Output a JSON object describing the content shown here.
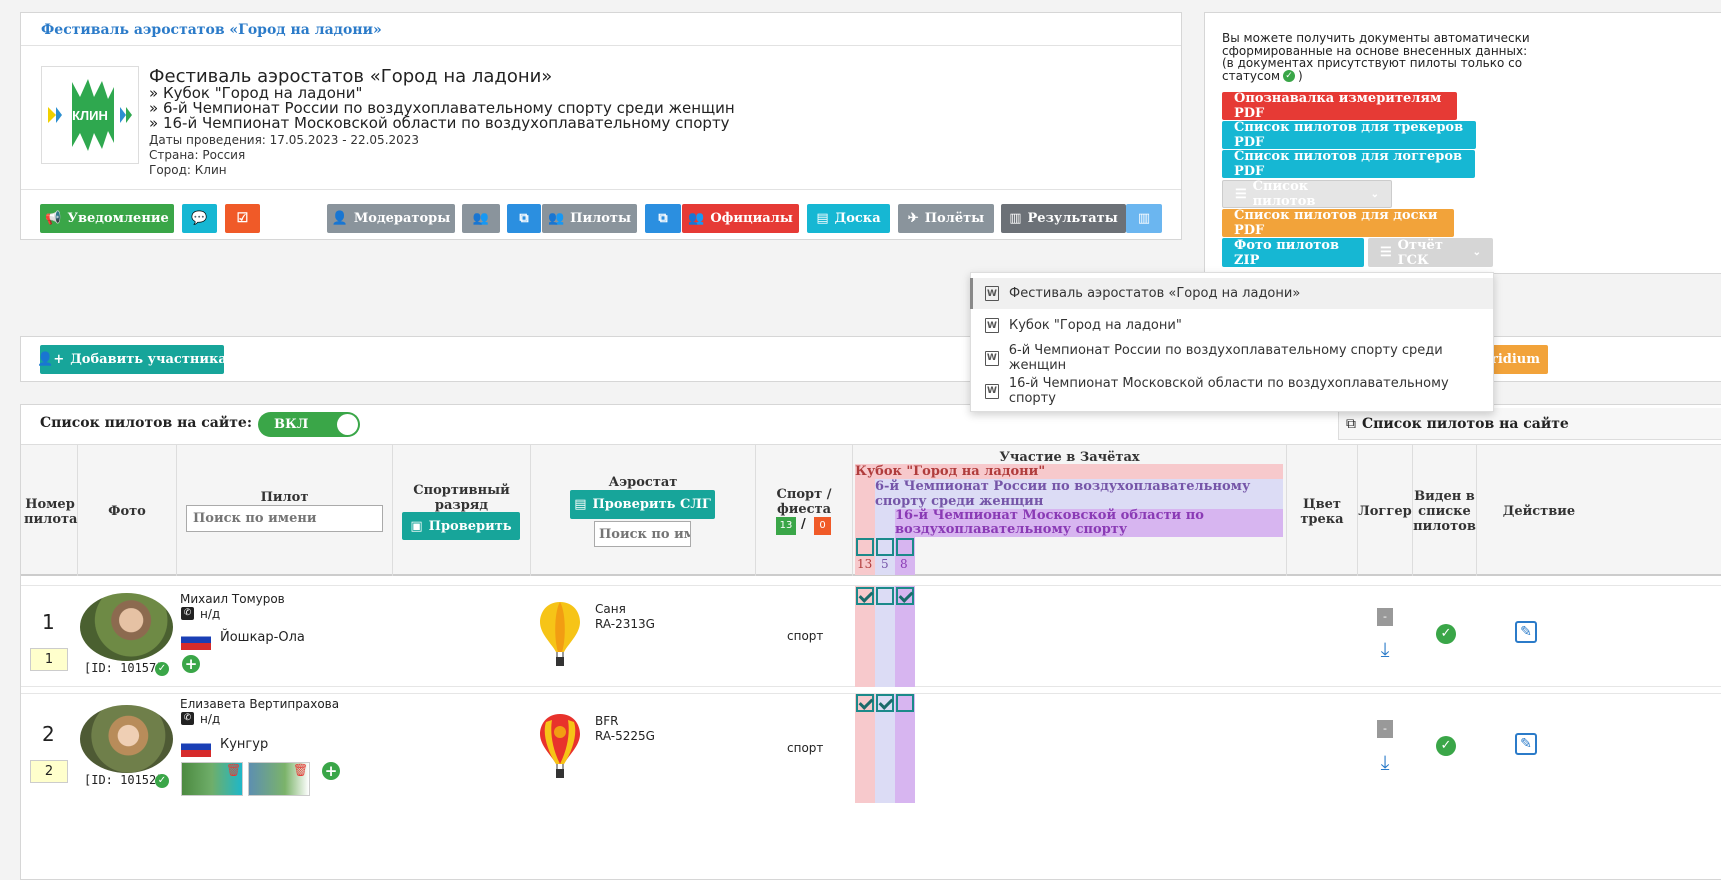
{
  "event": {
    "header_link": "Фестиваль аэростатов «Город на ладони»",
    "title": "Фестиваль аэростатов «Город на ладони»",
    "subs": [
      "» Кубок \"Город на ладони\"",
      "» 6-й Чемпионат России по воздухоплавательному спорту среди женщин",
      "» 16-й Чемпионат Московской области по воздухоплавательному спорту"
    ],
    "dates": "Даты проведения: 17.05.2023 - 22.05.2023",
    "country": "Страна: Россия",
    "city": "Город: Клин",
    "logo_text": "КЛИН"
  },
  "toolbar": {
    "notify": "Уведомление",
    "moderators": "Модераторы",
    "pilots": "Пилоты",
    "officials": "Официалы",
    "board": "Доска",
    "flights": "Полёты",
    "results": "Результаты"
  },
  "docs": {
    "info": [
      "Вы можете получить документы автоматически",
      "сформированные на основе внесенных данных:",
      "(в документах присутствуют пилоты только со",
      "статусом"
    ],
    "info_close": ")",
    "btn1": "Опознавалка измерителям PDF",
    "btn2": "Список пилотов для трекеров PDF",
    "btn3": "Список пилотов для логгеров PDF",
    "btn4": "Список пилотов",
    "btn5": "Список пилотов для доски PDF",
    "btn6": "Фото пилотов ZIP",
    "btn7": "Отчёт ГСК",
    "behind": "ridium"
  },
  "dropdown": [
    "Фестиваль аэростатов «Город на ладони»",
    "Кубок \"Город на ладони\"",
    "6-й Чемпионат России по воздухоплавательному спорту среди женщин",
    "16-й Чемпионат Московской области по воздухоплавательному спорту"
  ],
  "add_participant": "Добавить участника",
  "list": {
    "label": "Список пилотов на сайте:",
    "toggle": "ВКЛ",
    "link": "Список пилотов на сайте"
  },
  "table": {
    "h_number": "Номер пилота",
    "h_photo": "Фото",
    "h_pilot": "Пилот",
    "pilot_placeholder": "Поиск по имени",
    "h_rank": "Спортивный разряд",
    "btn_check": "Проверить",
    "h_balloon": "Аэростат",
    "btn_check_slg": "Проверить СЛГ",
    "balloon_placeholder": "Поиск по имени",
    "h_sport": "Спорт / фиеста",
    "sport_count": "13",
    "sport_sep": "/",
    "fiesta_count": "0",
    "h_comp": "Участие в Зачётах",
    "comp1": "Кубок \"Город на ладони\"",
    "comp2": "6-й Чемпионат России по воздухоплавательному спорту среди женщин",
    "comp3": "16-й Чемпионат Московской области по воздухоплавательному спорту",
    "counts": [
      "13",
      "5",
      "8"
    ],
    "h_color": "Цвет трека",
    "h_logger": "Логгер",
    "h_visible": "Виден в списке пилотов",
    "h_action": "Действие"
  },
  "rows": [
    {
      "num": "1",
      "badge": "1",
      "name": "Михаил Томуров",
      "phone": "н/д",
      "city": "Йошкар-Ола",
      "id": "[ID: 10157]",
      "balloon": "Саня",
      "reg": "RA-2313G",
      "type": "спорт",
      "comps": [
        true,
        false,
        true
      ],
      "logger": "-"
    },
    {
      "num": "2",
      "badge": "2",
      "name": "Елизавета Вертипрахова",
      "phone": "н/д",
      "city": "Кунгур",
      "id": "[ID: 10152]",
      "balloon": "BFR",
      "reg": "RA-5225G",
      "type": "спорт",
      "comps": [
        true,
        true,
        false
      ],
      "logger": "-"
    }
  ],
  "colors": {
    "green": "#3aa648",
    "cyan": "#16b7d3",
    "red": "#e63a35",
    "teal": "#17a59a",
    "pink": "#f7c9cc",
    "lavender": "#dcdcf5",
    "purple": "#d7b5f0"
  }
}
